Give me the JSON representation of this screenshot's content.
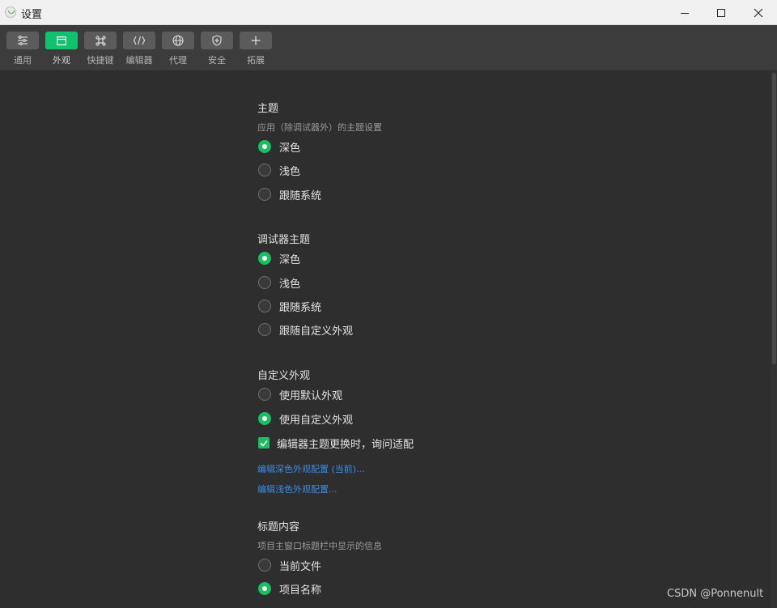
{
  "window": {
    "title": "设置",
    "logo_icon": "mini-program-logo-icon",
    "controls": {
      "minimize_icon": "minimize-icon",
      "maximize_icon": "maximize-icon",
      "close_icon": "close-icon"
    }
  },
  "toolbar": {
    "active_color": "#0ec26e",
    "items": [
      {
        "label": "通用",
        "icon": "sliders-icon"
      },
      {
        "label": "外观",
        "icon": "window-icon",
        "active": true
      },
      {
        "label": "快捷键",
        "icon": "command-key-icon"
      },
      {
        "label": "编辑器",
        "icon": "code-icon"
      },
      {
        "label": "代理",
        "icon": "globe-icon"
      },
      {
        "label": "安全",
        "icon": "shield-icon"
      },
      {
        "label": "拓展",
        "icon": "plus-icon"
      }
    ]
  },
  "sections": {
    "theme": {
      "title": "主题",
      "desc": "应用（除调试器外）的主题设置",
      "options": [
        "深色",
        "浅色",
        "跟随系统"
      ],
      "selected": "深色"
    },
    "debugger_theme": {
      "title": "调试器主题",
      "options": [
        "深色",
        "浅色",
        "跟随系统",
        "跟随自定义外观"
      ],
      "selected": "深色"
    },
    "custom_appearance": {
      "title": "自定义外观",
      "options": [
        "使用默认外观",
        "使用自定义外观"
      ],
      "selected": "使用自定义外观",
      "checkbox_label": "编辑器主题更换时，询问适配",
      "checkbox_checked": true,
      "link_dark": "编辑深色外观配置 (当前)...",
      "link_light": "编辑浅色外观配置..."
    },
    "title_content": {
      "title": "标题内容",
      "desc": "项目主窗口标题栏中显示的信息",
      "options": [
        "当前文件",
        "项目名称"
      ],
      "selected": "项目名称"
    }
  },
  "accent_color": "#17c15f",
  "link_color": "#3a8ee6",
  "watermark": "CSDN @Ponnenult"
}
